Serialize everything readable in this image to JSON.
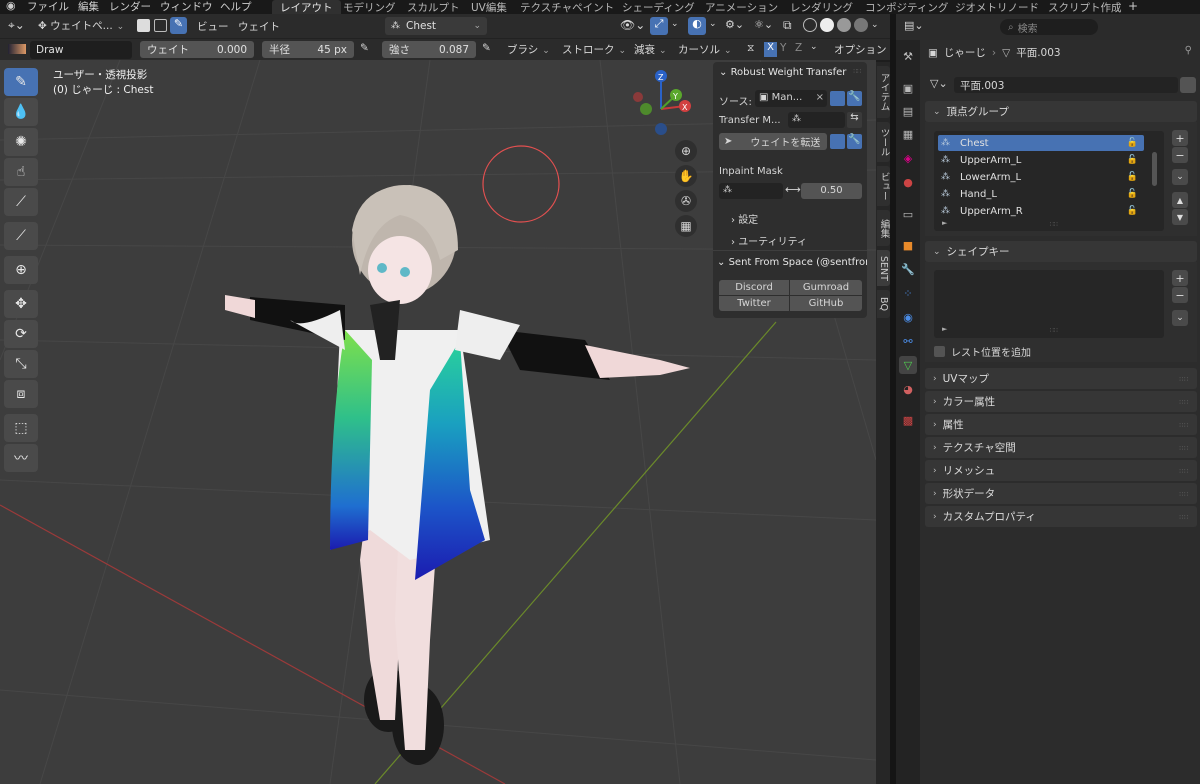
{
  "menu": {
    "items": [
      "ファイル",
      "編集",
      "レンダー",
      "ウィンドウ",
      "ヘルプ"
    ],
    "workspaces": [
      "レイアウト",
      "モデリング",
      "スカルプト",
      "UV編集",
      "テクスチャペイント",
      "シェーディング",
      "アニメーション",
      "レンダリング",
      "コンポジティング",
      "ジオメトリノード",
      "スクリプト作成"
    ],
    "add": "+"
  },
  "header": {
    "mode": "ウェイトペ...",
    "view": "ビュー",
    "weights": "ウェイト",
    "vgroup": "Chest"
  },
  "toolsettings": {
    "brush": "Draw",
    "weight_label": "ウェイト",
    "weight_value": "0.000",
    "radius_label": "半径",
    "radius_value": "45 px",
    "strength_label": "強さ",
    "strength_value": "0.087",
    "brush_menu": "ブラシ",
    "stroke_menu": "ストローク",
    "falloff_menu": "減衰",
    "cursor_menu": "カーソル",
    "x": "X",
    "y": "Y",
    "z": "Z",
    "options": "オプション"
  },
  "viewport": {
    "view_name": "ユーザー・透視投影",
    "object_info": "(0) じゃーじ : Chest",
    "gizmo": {
      "x": "X",
      "y": "Y",
      "z": "Z"
    }
  },
  "npanel": {
    "title": "Robust Weight Transfer",
    "source_label": "ソース:",
    "source_value": "Man...",
    "transfer_label": "Transfer M...",
    "transfer_button": "ウェイトを転送",
    "inpaint_label": "Inpaint Mask",
    "inpaint_value": "0.50",
    "settings": "設定",
    "utility": "ユーティリティ",
    "sent_title": "Sent From Space (@sentfroms",
    "links": [
      "Discord",
      "Gumroad",
      "Twitter",
      "GitHub"
    ],
    "tabs": [
      "アイテム",
      "ツール",
      "ビュー",
      "編集",
      "SENT",
      "BQ"
    ]
  },
  "props": {
    "search_placeholder": "検索",
    "breadcrumb_obj": "じゃーじ",
    "breadcrumb_data": "平面.003",
    "mesh_name": "平面.003",
    "vgroups_title": "頂点グループ",
    "vgroups": [
      "Chest",
      "UpperArm_L",
      "LowerArm_L",
      "Hand_L",
      "UpperArm_R"
    ],
    "shapekeys_title": "シェイプキー",
    "rest_pos": "レスト位置を追加",
    "sections": [
      "UVマップ",
      "カラー属性",
      "属性",
      "テクスチャ空間",
      "リメッシュ",
      "形状データ",
      "カスタムプロパティ"
    ]
  },
  "colors": {
    "accent": "#4772b3",
    "viewport_bg": "#3d3d3d"
  }
}
